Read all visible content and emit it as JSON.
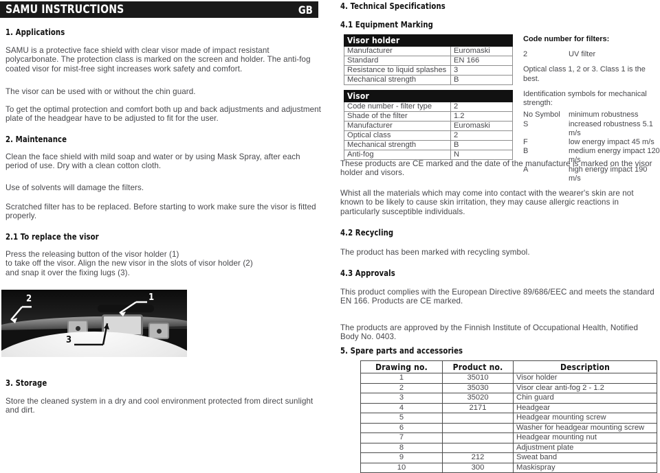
{
  "header": {
    "title": "SAMU INSTRUCTIONS",
    "language": "GB"
  },
  "left": {
    "s1_heading": "1. Applications",
    "s1_p1": "SAMU is a protective face shield with clear visor made of impact resistant polycarbonate. The protection class is marked on the screen and holder. The anti-fog coated visor for mist-free sight increases work safety and comfort.",
    "s1_p2": "The visor can be used with or without the chin guard.",
    "s1_p3": "To get the optimal protection and comfort both up and back adjustments and adjustment plate of the headgear have to be adjusted to fit for the user.",
    "s2_heading": "2. Maintenance",
    "s2_p1": "Clean the face shield with mild soap and water or by using Mask Spray, after each period of use. Dry with a clean cotton cloth.",
    "s2_p2": "Use of solvents will damage the filters.",
    "s2_p3": "Scratched filter has to be replaced. Before starting to work make sure the visor is fitted properly.",
    "s21_heading": "2.1 To replace the visor",
    "s21_p1": "Press the releasing button of the visor holder (1)",
    "s21_p2": "to take off the visor. Align the new visor in the slots of visor holder (2)",
    "s21_p3": "and snap it over the fixing lugs (3).",
    "photo_callouts": [
      "1",
      "2",
      "3"
    ],
    "s3_heading": "3. Storage",
    "s3_p1": "Store the cleaned system in a dry and cool environment protected from direct sunlight and dirt."
  },
  "right": {
    "s4_heading": "4. Technical Specifications",
    "s41_heading": "4.1 Equipment Marking",
    "visor_holder_table": {
      "title": "Visor holder",
      "rows": [
        {
          "key": "Manufacturer",
          "value": "Euromaski"
        },
        {
          "key": "Standard",
          "value": "EN 166"
        },
        {
          "key": "Resistance to liquid splashes",
          "value": "3"
        },
        {
          "key": "Mechanical strength",
          "value": "B"
        }
      ]
    },
    "visor_table": {
      "title": "Visor",
      "rows": [
        {
          "key": "Code number - filter type",
          "value": "2"
        },
        {
          "key": "Shade of the filter",
          "value": "1.2"
        },
        {
          "key": "Manufacturer",
          "value": "Euromaski"
        },
        {
          "key": "Optical class",
          "value": "2"
        },
        {
          "key": "Mechanical strength",
          "value": "B"
        },
        {
          "key": "Anti-fog",
          "value": "N"
        }
      ]
    },
    "filter_codes": {
      "title": "Code number for filters:",
      "code": "2",
      "code_label": "UV filter",
      "optical_note": "Optical class 1, 2 or 3. Class 1 is the best."
    },
    "mech_symbols": {
      "title": "Identification symbols for mechanical strength:",
      "rows": [
        {
          "symbol": "No Symbol",
          "desc": "minimum robustness"
        },
        {
          "symbol": "S",
          "desc": "increased robustness 5.1 m/s"
        },
        {
          "symbol": "F",
          "desc": "low energy impact 45 m/s"
        },
        {
          "symbol": "B",
          "desc": "medium energy impact 120 m/s"
        },
        {
          "symbol": "A",
          "desc": "high energy impact 190 m/s"
        }
      ]
    },
    "ce_note": "These products are CE marked and the date of the manufacture is marked on the visor holder and visors.",
    "skin_note": "Whist all the materials which may come into contact with the wearer's skin are not known to be likely to cause skin irritation, they may cause allergic reactions in particularly susceptible individuals.",
    "s42_heading": "4.2 Recycling",
    "s42_p1": "The product has been marked with recycling symbol.",
    "s43_heading": "4.3 Approvals",
    "s43_p1": "This product complies with the European Directive 89/686/EEC and meets the standard EN 166. Products are CE marked.",
    "s43_p2": "The products are approved by the Finnish Institute of Occupational Health, Notified Body No. 0403.",
    "s5_heading": "5. Spare parts and accessories",
    "parts_table": {
      "columns": [
        "Drawing no.",
        "Product no.",
        "Description"
      ],
      "rows": [
        {
          "drawing": "1",
          "product": "35010",
          "description": "Visor holder"
        },
        {
          "drawing": "2",
          "product": "35030",
          "description": "Visor clear anti-fog 2 - 1.2"
        },
        {
          "drawing": "3",
          "product": "35020",
          "description": "Chin guard"
        },
        {
          "drawing": "4",
          "product": "2171",
          "description": "Headgear"
        },
        {
          "drawing": "5",
          "product": "",
          "description": "Headgear mounting screw"
        },
        {
          "drawing": "6",
          "product": "",
          "description": "Washer for headgear mounting screw"
        },
        {
          "drawing": "7",
          "product": "",
          "description": "Headgear mounting nut"
        },
        {
          "drawing": "8",
          "product": "",
          "description": "Adjustment plate"
        },
        {
          "drawing": "9",
          "product": "212",
          "description": "Sweat band"
        },
        {
          "drawing": "10",
          "product": "300",
          "description": "Maskispray"
        }
      ]
    }
  }
}
